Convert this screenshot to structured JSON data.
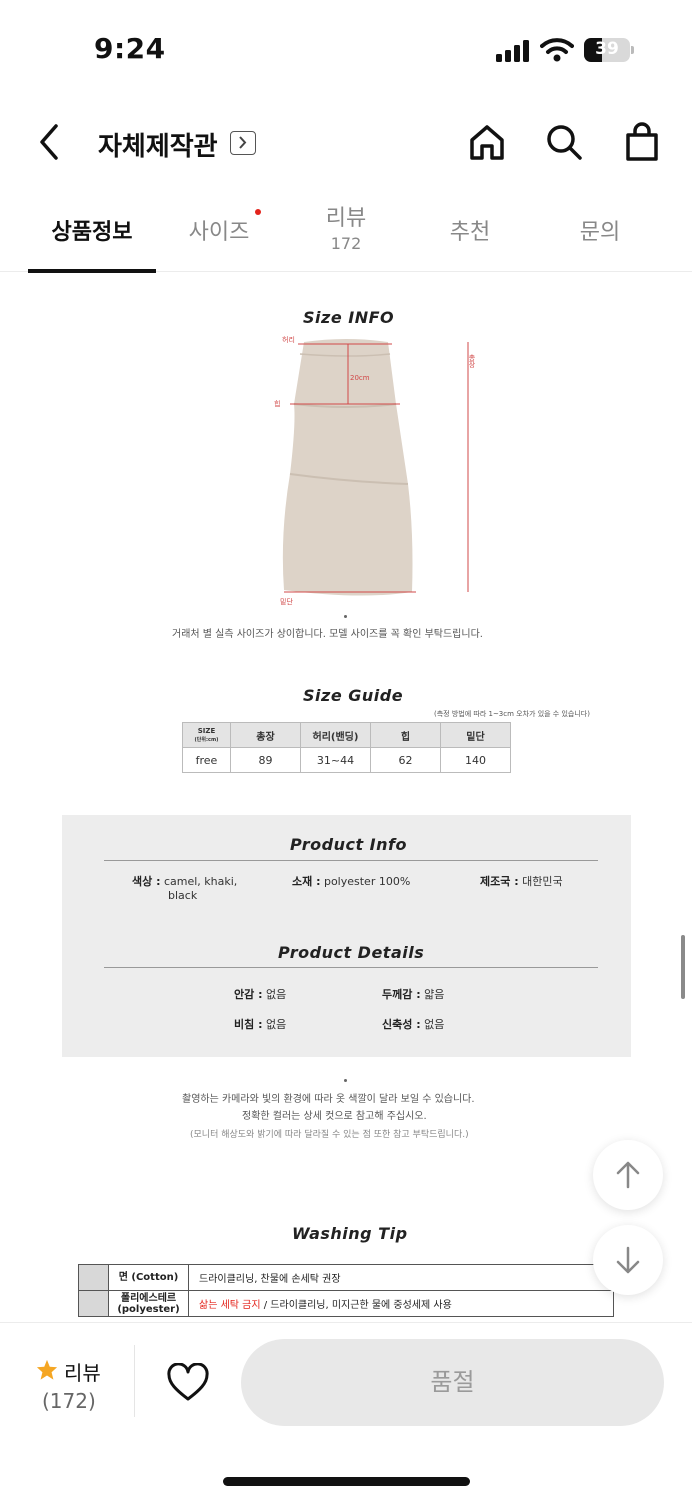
{
  "status": {
    "time": "9:24",
    "battery": "39",
    "battery_level": 0.39
  },
  "header": {
    "title": "자체제작관",
    "title_chevron": "chevron-right-icon"
  },
  "tabs": [
    {
      "label": "상품정보",
      "active": true
    },
    {
      "label": "사이즈",
      "has_dot": true
    },
    {
      "label": "리뷰",
      "count": "172"
    },
    {
      "label": "추천"
    },
    {
      "label": "문의"
    }
  ],
  "size_info": {
    "title": "Size INFO",
    "label_waist": "허리",
    "label_hip": "힙",
    "label_hem": "밑단",
    "label_length": "총장",
    "hip_depth": "20cm",
    "note": "거래처 별 실측 사이즈가 상이합니다. 모델 사이즈를 꼭 확인 부탁드립니다."
  },
  "size_guide": {
    "title": "Size Guide",
    "note": "(측정 방법에 따라 1~3cm 오차가 있을 수 있습니다)",
    "headers": [
      "SIZE",
      "총장",
      "허리(밴딩)",
      "힙",
      "밑단"
    ],
    "size_unit": "(단위:cm)",
    "rows": [
      [
        "free",
        "89",
        "31~44",
        "62",
        "140"
      ]
    ]
  },
  "product_info": {
    "title": "Product Info",
    "color_label": "색상 :",
    "color_value_1": "camel, khaki,",
    "color_value_2": "black",
    "material_label": "소재 :",
    "material_value": "polyester 100%",
    "origin_label": "제조국 :",
    "origin_value": "대한민국"
  },
  "product_details": {
    "title": "Product Details",
    "lining_label": "안감 :",
    "lining_value": "없음",
    "thickness_label": "두께감 :",
    "thickness_value": "얇음",
    "sheer_label": "비침 :",
    "sheer_value": "없음",
    "stretch_label": "신축성 :",
    "stretch_value": "없음"
  },
  "color_note": {
    "line1": "촬영하는 카메라와 빛의 환경에 따라 옷 색깔이 달라 보일 수 있습니다.",
    "line2": "정확한 컬러는 상세 컷으로 참고해 주십시오.",
    "line3": "(모니터 해상도와 밝기에 따라 달라질 수 있는 점 또한 참고 부탁드립니다.)"
  },
  "washing": {
    "title": "Washing Tip",
    "rows": [
      {
        "material": "면 (Cotton)",
        "warn": "",
        "text": "드라이클리닝, 찬물에 손세탁 권장"
      },
      {
        "material": "폴리에스테르",
        "material_2": "(polyester)",
        "warn": "삶는 세탁 금지",
        "text": " / 드라이클리닝, 미지근한 물에 중성세제 사용"
      }
    ]
  },
  "bottom": {
    "review_label": "리뷰",
    "review_count": "(172)",
    "soldout_label": "품절"
  },
  "colors": {
    "accent_red": "#e3231b",
    "star": "#f5a623"
  }
}
